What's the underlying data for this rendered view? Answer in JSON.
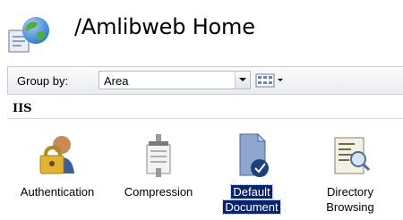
{
  "header": {
    "title": "/Amlibweb Home"
  },
  "toolbar": {
    "groupby_label": "Group by:",
    "groupby_value": "Area"
  },
  "section": {
    "title": "IIS"
  },
  "features": [
    {
      "label": "Authentication",
      "icon": "authentication-icon",
      "selected": false
    },
    {
      "label": "Compression",
      "icon": "compression-icon",
      "selected": false
    },
    {
      "label_line1": "Default",
      "label_line2": "Document",
      "icon": "default-document-icon",
      "selected": true
    },
    {
      "label_line1": "Directory",
      "label_line2": "Browsing",
      "icon": "directory-browsing-icon",
      "selected": false
    }
  ],
  "colors": {
    "selection": "#0a246a",
    "toolbar_top": "#fbfbfb",
    "toolbar_bottom": "#e9ecf1"
  }
}
